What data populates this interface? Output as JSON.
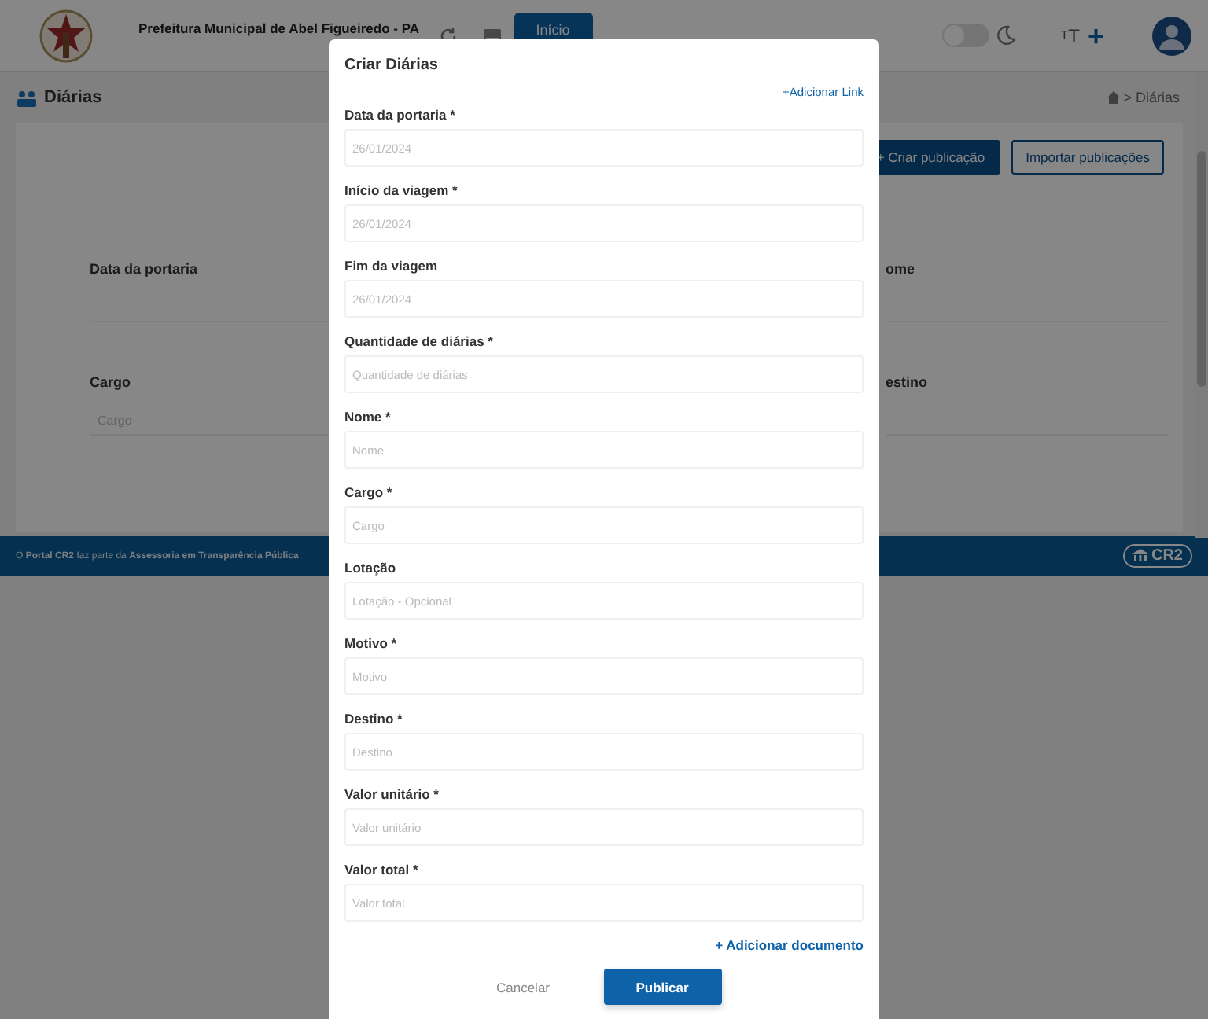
{
  "header": {
    "title": "Prefeitura Municipal de Abel Figueiredo - PA",
    "home_button": "Início",
    "dark_mode": {
      "on": false
    },
    "font_small": "T",
    "font_large": "T",
    "font_increase": "+"
  },
  "page": {
    "title": "Diárias",
    "breadcrumb": "> Diárias",
    "create_button": "+ Criar publicação",
    "import_button": "Importar publicações"
  },
  "filters": [
    {
      "label": "Data da portaria"
    },
    {
      "label": "ome"
    },
    {
      "label": "Cargo",
      "placeholder": "Cargo"
    },
    {
      "label": "estino"
    }
  ],
  "footer": {
    "text": "O **Portal CR2** faz parte da **Assessoria em Transparência Pública**",
    "logo": "CR2"
  },
  "modal": {
    "title": "Criar Diárias",
    "add_link": "+Adicionar Link",
    "fields": [
      {
        "label": "Data da portaria *",
        "placeholder": "26/01/2024"
      },
      {
        "label": "Início da viagem *",
        "placeholder": "26/01/2024"
      },
      {
        "label": "Fim da viagem",
        "placeholder": "26/01/2024"
      },
      {
        "label": "Quantidade de diárias *",
        "placeholder": "Quantidade de diárias"
      },
      {
        "label": "Nome *",
        "placeholder": "Nome"
      },
      {
        "label": "Cargo *",
        "placeholder": "Cargo"
      },
      {
        "label": "Lotação",
        "placeholder": "Lotação - Opcional"
      },
      {
        "label": "Motivo *",
        "placeholder": "Motivo"
      },
      {
        "label": "Destino *",
        "placeholder": "Destino"
      },
      {
        "label": "Valor unitário *",
        "placeholder": "Valor unitário"
      },
      {
        "label": "Valor total *",
        "placeholder": "Valor total"
      }
    ],
    "add_document": "+ Adicionar documento",
    "cancel": "Cancelar",
    "submit": "Publicar"
  }
}
